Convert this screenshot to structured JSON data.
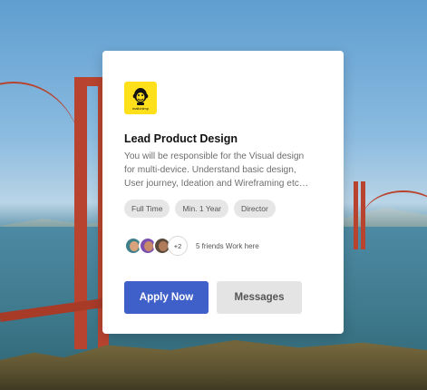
{
  "job": {
    "company_logo_text": "mailchimp",
    "title": "Lead Product Design",
    "description": "You will be responsible for the Visual design for multi-device. Understand basic design, User journey, Ideation and Wireframing etc…",
    "tags": [
      "Full Time",
      "Min. 1 Year",
      "Director"
    ],
    "friends": {
      "more_count": "+2",
      "text": "5 friends Work here"
    },
    "actions": {
      "apply_label": "Apply Now",
      "messages_label": "Messages"
    }
  },
  "colors": {
    "primary": "#4060c9",
    "logo_bg": "#ffe01b",
    "secondary_bg": "#e4e4e4"
  },
  "icons": {
    "logo": "mailchimp-freddie-icon",
    "avatars": [
      "friend-avatar-1",
      "friend-avatar-2",
      "friend-avatar-3"
    ]
  }
}
